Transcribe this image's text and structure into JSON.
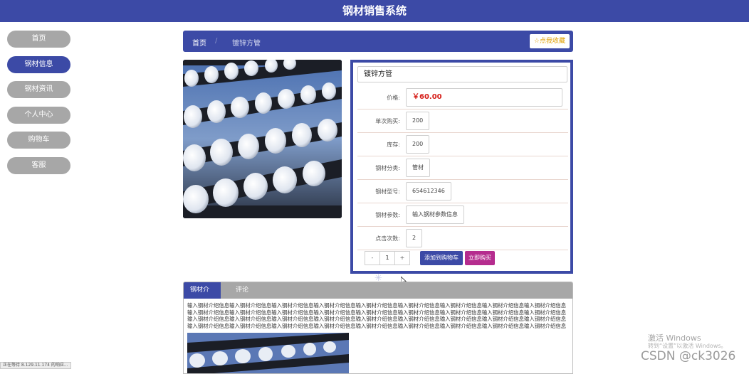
{
  "header": {
    "title": "钢材销售系统"
  },
  "sidebar": {
    "items": [
      {
        "label": "首页"
      },
      {
        "label": "钢材信息"
      },
      {
        "label": "钢材资讯"
      },
      {
        "label": "个人中心"
      },
      {
        "label": "购物车"
      },
      {
        "label": "客服"
      }
    ]
  },
  "breadcrumb": {
    "home": "首页",
    "separator": "/",
    "current": "镀锌方管"
  },
  "favorite_button": "☆点我收藏",
  "product": {
    "name": "镀锌方管",
    "price_label": "价格:",
    "price": "￥60.00",
    "per_purchase_label": "单次购买:",
    "per_purchase": "200",
    "stock_label": "库存:",
    "stock": "200",
    "category_label": "钢材分类:",
    "category": "管材",
    "model_label": "钢材型号:",
    "model": "654612346",
    "params_label": "钢材参数:",
    "params": "输入钢材参数信息",
    "clicks_label": "点击次数:",
    "clicks": "2"
  },
  "purchase": {
    "minus": "-",
    "quantity": "1",
    "plus": "+",
    "add_to_cart": "添加到购物车",
    "buy_now": "立即购买"
  },
  "tabs": [
    {
      "label": "钢材介绍"
    },
    {
      "label": "评论"
    }
  ],
  "description": "输入钢材介绍信息输入钢材介绍信息输入钢材介绍信息输入钢材介绍信息输入钢材介绍信息输入钢材介绍信息输入钢材介绍信息输入钢材介绍信息输入钢材介绍信息输入钢材介绍信息输入钢材介绍信息输入钢材介绍信息输入钢材介绍信息输入钢材介绍信息输入钢材介绍信息输入钢材介绍信息输入钢材介绍信息输入钢材介绍信息输入钢材介绍信息输入钢材介绍信息输入钢材介绍信息输入钢材介绍信息输入钢材介绍信息输入钢材介绍信息输入钢材介绍信息输入钢材介绍信息输入钢材介绍信息输入钢材介绍信息输入钢材介绍信息输入钢材介绍信息输入钢材介绍信息输入钢材介绍信息输入钢材介绍信息输入钢材介绍信息输入钢材介绍信息输入钢材介绍信息",
  "status_bar": "正在等待 8.129.11.174 的响应...",
  "watermark": {
    "line1": "激活 Windows",
    "line2": "转到“设置”以激活 Windows。",
    "csdn": "CSDN @ck3026"
  },
  "colors": {
    "primary": "#3c4aa6",
    "inactive": "#a7a7a7",
    "price": "#d6201b",
    "buy": "#b52c8e",
    "favorite": "#e0a000"
  }
}
